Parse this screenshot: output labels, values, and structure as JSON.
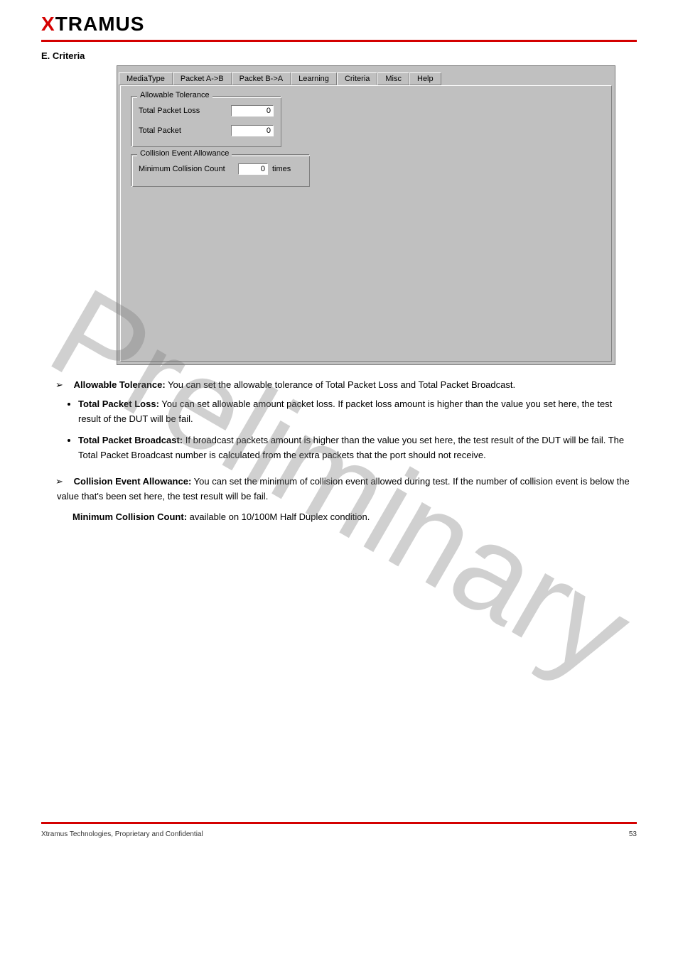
{
  "header": {
    "logo_prefix": "X",
    "logo_rest": "TRAMUS"
  },
  "section_title": "E. Criteria",
  "screenshot": {
    "tabs": [
      {
        "label": "MediaType",
        "active": false
      },
      {
        "label": "Packet A->B",
        "active": false
      },
      {
        "label": "Packet B->A",
        "active": false
      },
      {
        "label": "Learning",
        "active": false
      },
      {
        "label": "Criteria",
        "active": true
      },
      {
        "label": "Misc",
        "active": false
      },
      {
        "label": "Help",
        "active": false
      }
    ],
    "group1": {
      "legend": "Allowable Tolerance",
      "row1_label": "Total Packet Loss",
      "row1_value": "0",
      "row2_label": "Total Packet",
      "row2_value": "0"
    },
    "group2": {
      "legend": "Collision Event Allowance",
      "row1_label": "Minimum Collision Count",
      "row1_value": "0",
      "row1_unit": "times"
    }
  },
  "body": {
    "arrow1_title": "Allowable Tolerance:",
    "arrow1_text": " You can set the allowable tolerance of Total Packet Loss and Total Packet Broadcast.",
    "disc1_title": "Total Packet Loss:",
    "disc1_text": " You can set allowable amount packet loss. If packet loss amount is higher than the value you set here, the test result of the DUT will be fail.",
    "disc2_title": "Total Packet Broadcast:",
    "disc2_text": " If broadcast packets amount is higher than the value you set here, the test result of the DUT will be fail. The Total Packet Broadcast number is calculated from the extra packets that the port should not receive.",
    "arrow2_title": "Collision Event Allowance:",
    "arrow2_text": " You can set the minimum of collision event allowed during test. If the number of collision event is below the value that's been set here, the test result will be fail.",
    "arrow2_note_title": "Minimum Collision Count:",
    "arrow2_note_text": " available on 10/100M Half Duplex condition."
  },
  "footer": {
    "left": "Xtramus Technologies, Proprietary and Confidential",
    "right": "53"
  }
}
